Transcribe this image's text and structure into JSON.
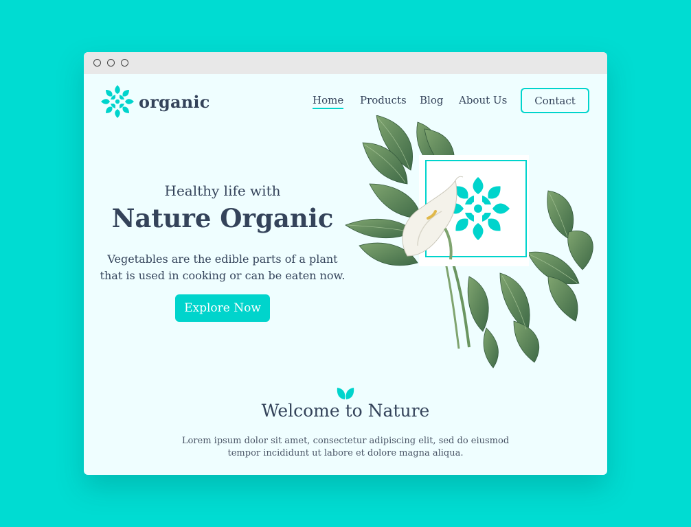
{
  "window": {
    "controls": [
      "close",
      "minimize",
      "maximize"
    ]
  },
  "brand": {
    "name": "organic",
    "icon": "mandala-logo-icon",
    "color": "#00d4cc"
  },
  "nav": {
    "items": [
      {
        "label": "Home",
        "active": true
      },
      {
        "label": "Products",
        "active": false
      },
      {
        "label": "Blog",
        "active": false
      },
      {
        "label": "About Us",
        "active": false
      }
    ],
    "contact_label": "Contact"
  },
  "hero": {
    "subtitle": "Healthy life with",
    "title": "Nature Organic",
    "description": "Vegetables are the edible parts of a plant that is used in cooking or can be eaten now.",
    "cta_label": "Explore Now",
    "illustration": "calla-lily-leaves-with-logo-frame"
  },
  "section": {
    "icon": "leaf-icon",
    "title": "Welcome to Nature",
    "body": "Lorem ipsum dolor sit amet, consectetur adipiscing elit, sed do eiusmod tempor incididunt ut labore et dolore magna aliqua."
  },
  "colors": {
    "background": "#00dcd2",
    "page": "#effeff",
    "accent": "#00d4cc",
    "text": "#34435a"
  }
}
